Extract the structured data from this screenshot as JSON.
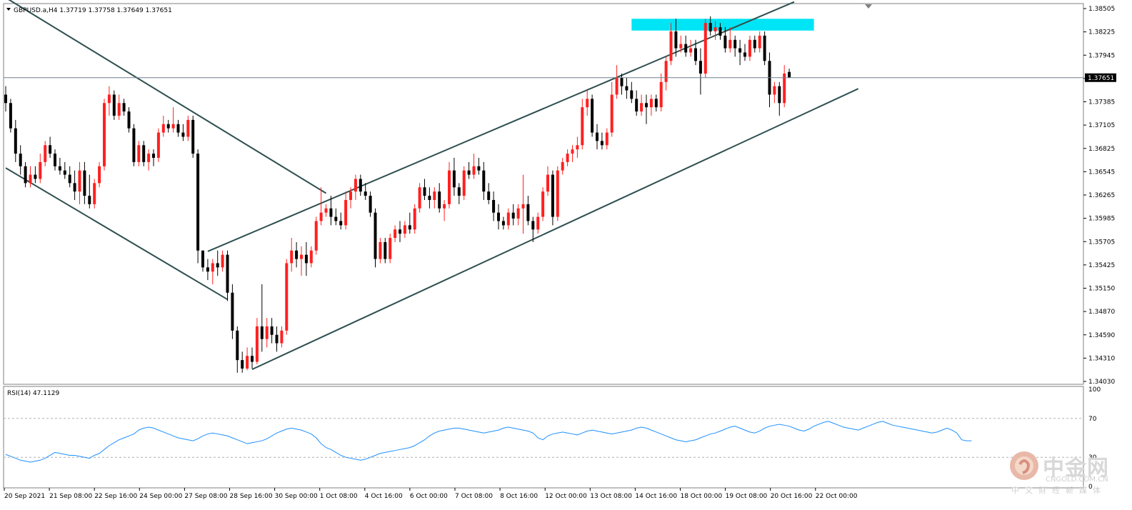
{
  "chart_header": {
    "symbol_line": "GBPUSD.a,H4  1.37719 1.37758 1.37649 1.37651",
    "current_price_label": "1.37651"
  },
  "rsi_header": "RSI(14) 47.1129",
  "price_axis_labels": [
    "1.38505",
    "1.38225",
    "1.37945",
    "1.37665",
    "1.37385",
    "1.37105",
    "1.36825",
    "1.36545",
    "1.36265",
    "1.35985",
    "1.35705",
    "1.35425",
    "1.35150",
    "1.34870",
    "1.34590",
    "1.34310",
    "1.34030"
  ],
  "rsi_axis_labels": [
    "100",
    "70",
    "30",
    "0"
  ],
  "time_axis_labels": [
    "20 Sep 2021",
    "21 Sep 08:00",
    "22 Sep 16:00",
    "24 Sep 00:00",
    "27 Sep 08:00",
    "28 Sep 16:00",
    "30 Sep 00:00",
    "1 Oct 08:00",
    "4 Oct 16:00",
    "6 Oct 00:00",
    "7 Oct 08:00",
    "8 Oct 16:00",
    "12 Oct 00:00",
    "13 Oct 08:00",
    "14 Oct 16:00",
    "18 Oct 00:00",
    "19 Oct 08:00",
    "20 Oct 16:00",
    "22 Oct 00:00"
  ],
  "watermark": {
    "cn": "中金网",
    "en": "CNGOLD.COM.CN",
    "sub": "中文财经新媒体"
  },
  "colors": {
    "bull": "#ff2020",
    "bear": "#000000",
    "neutral": "#00c000",
    "resistance_zone": "#00e5f5",
    "rsi_line": "#1e90ff",
    "trendline": "#2f4f4f"
  },
  "chart_data": {
    "type": "candlestick",
    "symbol": "GBPUSD.a",
    "timeframe": "H4",
    "ylim": [
      1.3403,
      1.38505
    ],
    "candles": [
      [
        1.3745,
        1.3755,
        1.3725,
        1.3735
      ],
      [
        1.3735,
        1.374,
        1.37,
        1.3705
      ],
      [
        1.3705,
        1.3715,
        1.3665,
        1.3675
      ],
      [
        1.3675,
        1.3685,
        1.365,
        1.366
      ],
      [
        1.366,
        1.3665,
        1.3635,
        1.364
      ],
      [
        1.364,
        1.366,
        1.3635,
        1.365
      ],
      [
        1.365,
        1.366,
        1.364,
        1.3645
      ],
      [
        1.3645,
        1.3675,
        1.364,
        1.3665
      ],
      [
        1.3665,
        1.369,
        1.366,
        1.3685
      ],
      [
        1.3685,
        1.3695,
        1.367,
        1.3675
      ],
      [
        1.3675,
        1.368,
        1.3655,
        1.366
      ],
      [
        1.366,
        1.367,
        1.365,
        1.3655
      ],
      [
        1.3655,
        1.3665,
        1.3645,
        1.365
      ],
      [
        1.365,
        1.366,
        1.3635,
        1.364
      ],
      [
        1.364,
        1.3655,
        1.362,
        1.363
      ],
      [
        1.363,
        1.3665,
        1.3615,
        1.3655
      ],
      [
        1.3655,
        1.3665,
        1.3615,
        1.3625
      ],
      [
        1.3625,
        1.365,
        1.361,
        1.3615
      ],
      [
        1.3615,
        1.3645,
        1.361,
        1.364
      ],
      [
        1.364,
        1.3665,
        1.3635,
        1.366
      ],
      [
        1.366,
        1.374,
        1.3655,
        1.3735
      ],
      [
        1.3735,
        1.3755,
        1.372,
        1.3745
      ],
      [
        1.3745,
        1.375,
        1.3715,
        1.372
      ],
      [
        1.372,
        1.3745,
        1.3715,
        1.3735
      ],
      [
        1.3735,
        1.374,
        1.372,
        1.3725
      ],
      [
        1.3725,
        1.373,
        1.37,
        1.3705
      ],
      [
        1.3705,
        1.371,
        1.366,
        1.3665
      ],
      [
        1.3665,
        1.369,
        1.366,
        1.3685
      ],
      [
        1.3685,
        1.369,
        1.366,
        1.3665
      ],
      [
        1.3665,
        1.368,
        1.3655,
        1.3675
      ],
      [
        1.3675,
        1.368,
        1.366,
        1.367
      ],
      [
        1.367,
        1.3705,
        1.3665,
        1.37
      ],
      [
        1.37,
        1.372,
        1.3695,
        1.371
      ],
      [
        1.371,
        1.3715,
        1.37,
        1.3705
      ],
      [
        1.3705,
        1.373,
        1.37,
        1.371
      ],
      [
        1.371,
        1.3715,
        1.3695,
        1.37
      ],
      [
        1.37,
        1.371,
        1.369,
        1.3695
      ],
      [
        1.3695,
        1.372,
        1.369,
        1.3715
      ],
      [
        1.3715,
        1.372,
        1.367,
        1.3675
      ],
      [
        1.3675,
        1.368,
        1.3545,
        1.356
      ],
      [
        1.356,
        1.356,
        1.3535,
        1.354
      ],
      [
        1.354,
        1.355,
        1.3525,
        1.3535
      ],
      [
        1.3535,
        1.355,
        1.352,
        1.3545
      ],
      [
        1.3545,
        1.356,
        1.353,
        1.354
      ],
      [
        1.354,
        1.356,
        1.3535,
        1.3555
      ],
      [
        1.3555,
        1.356,
        1.35,
        1.351
      ],
      [
        1.351,
        1.352,
        1.3455,
        1.3465
      ],
      [
        1.3465,
        1.347,
        1.3415,
        1.343
      ],
      [
        1.343,
        1.344,
        1.3415,
        1.342
      ],
      [
        1.342,
        1.3445,
        1.3418,
        1.3435
      ],
      [
        1.3435,
        1.3445,
        1.342,
        1.3428
      ],
      [
        1.3428,
        1.348,
        1.3425,
        1.347
      ],
      [
        1.347,
        1.352,
        1.344,
        1.3455
      ],
      [
        1.3455,
        1.348,
        1.3445,
        1.347
      ],
      [
        1.347,
        1.348,
        1.345,
        1.346
      ],
      [
        1.346,
        1.347,
        1.344,
        1.345
      ],
      [
        1.345,
        1.347,
        1.3445,
        1.3465
      ],
      [
        1.3465,
        1.355,
        1.346,
        1.3545
      ],
      [
        1.3545,
        1.3575,
        1.3535,
        1.356
      ],
      [
        1.356,
        1.357,
        1.354,
        1.355
      ],
      [
        1.355,
        1.3565,
        1.353,
        1.3555
      ],
      [
        1.3555,
        1.357,
        1.353,
        1.3545
      ],
      [
        1.3545,
        1.3565,
        1.354,
        1.356
      ],
      [
        1.356,
        1.36,
        1.3555,
        1.3595
      ],
      [
        1.3595,
        1.3635,
        1.359,
        1.3605
      ],
      [
        1.3605,
        1.3615,
        1.36,
        1.361
      ],
      [
        1.361,
        1.3625,
        1.359,
        1.36
      ],
      [
        1.36,
        1.361,
        1.359,
        1.3595
      ],
      [
        1.3595,
        1.3605,
        1.3585,
        1.359
      ],
      [
        1.359,
        1.363,
        1.3585,
        1.362
      ],
      [
        1.362,
        1.3635,
        1.361,
        1.363
      ],
      [
        1.363,
        1.365,
        1.362,
        1.3645
      ],
      [
        1.3645,
        1.365,
        1.3625,
        1.363
      ],
      [
        1.363,
        1.364,
        1.362,
        1.3625
      ],
      [
        1.3625,
        1.363,
        1.36,
        1.3605
      ],
      [
        1.3605,
        1.361,
        1.354,
        1.355
      ],
      [
        1.355,
        1.3575,
        1.3545,
        1.357
      ],
      [
        1.357,
        1.3575,
        1.3545,
        1.355
      ],
      [
        1.355,
        1.358,
        1.3545,
        1.3575
      ],
      [
        1.3575,
        1.359,
        1.357,
        1.3585
      ],
      [
        1.3585,
        1.3595,
        1.357,
        1.358
      ],
      [
        1.358,
        1.3595,
        1.3575,
        1.359
      ],
      [
        1.359,
        1.3605,
        1.358,
        1.3585
      ],
      [
        1.3585,
        1.3615,
        1.358,
        1.361
      ],
      [
        1.361,
        1.364,
        1.3605,
        1.3635
      ],
      [
        1.3635,
        1.3645,
        1.362,
        1.3625
      ],
      [
        1.3625,
        1.3635,
        1.361,
        1.362
      ],
      [
        1.362,
        1.3635,
        1.361,
        1.363
      ],
      [
        1.363,
        1.364,
        1.3605,
        1.361
      ],
      [
        1.361,
        1.362,
        1.3595,
        1.3615
      ],
      [
        1.3615,
        1.3665,
        1.361,
        1.3655
      ],
      [
        1.3655,
        1.367,
        1.3625,
        1.3635
      ],
      [
        1.3635,
        1.364,
        1.3615,
        1.3625
      ],
      [
        1.3625,
        1.366,
        1.362,
        1.3655
      ],
      [
        1.3655,
        1.3665,
        1.3645,
        1.365
      ],
      [
        1.365,
        1.3675,
        1.3645,
        1.366
      ],
      [
        1.366,
        1.367,
        1.365,
        1.3655
      ],
      [
        1.3655,
        1.3665,
        1.362,
        1.363
      ],
      [
        1.363,
        1.364,
        1.3615,
        1.362
      ],
      [
        1.362,
        1.363,
        1.3595,
        1.3605
      ],
      [
        1.3605,
        1.3615,
        1.3585,
        1.3595
      ],
      [
        1.3595,
        1.36,
        1.3585,
        1.359
      ],
      [
        1.359,
        1.361,
        1.3585,
        1.3605
      ],
      [
        1.3605,
        1.3615,
        1.359,
        1.3598
      ],
      [
        1.3598,
        1.3615,
        1.359,
        1.361
      ],
      [
        1.361,
        1.365,
        1.358,
        1.3615
      ],
      [
        1.3615,
        1.3625,
        1.359,
        1.3595
      ],
      [
        1.3595,
        1.36,
        1.357,
        1.3585
      ],
      [
        1.3585,
        1.3605,
        1.358,
        1.36
      ],
      [
        1.36,
        1.3635,
        1.3595,
        1.363
      ],
      [
        1.363,
        1.366,
        1.3625,
        1.365
      ],
      [
        1.365,
        1.3655,
        1.359,
        1.36
      ],
      [
        1.36,
        1.366,
        1.3595,
        1.3655
      ],
      [
        1.3655,
        1.367,
        1.365,
        1.3665
      ],
      [
        1.3665,
        1.368,
        1.366,
        1.3675
      ],
      [
        1.3675,
        1.3685,
        1.3665,
        1.368
      ],
      [
        1.368,
        1.3695,
        1.367,
        1.3685
      ],
      [
        1.3685,
        1.374,
        1.368,
        1.373
      ],
      [
        1.373,
        1.375,
        1.372,
        1.374
      ],
      [
        1.374,
        1.3745,
        1.3695,
        1.37
      ],
      [
        1.37,
        1.371,
        1.368,
        1.369
      ],
      [
        1.369,
        1.37,
        1.368,
        1.3685
      ],
      [
        1.3685,
        1.3705,
        1.368,
        1.37
      ],
      [
        1.37,
        1.376,
        1.3695,
        1.3745
      ],
      [
        1.3745,
        1.378,
        1.374,
        1.3765
      ],
      [
        1.3765,
        1.377,
        1.3745,
        1.3755
      ],
      [
        1.3755,
        1.3765,
        1.374,
        1.375
      ],
      [
        1.375,
        1.376,
        1.3735,
        1.374
      ],
      [
        1.374,
        1.375,
        1.372,
        1.3725
      ],
      [
        1.3725,
        1.3745,
        1.372,
        1.3735
      ],
      [
        1.3735,
        1.3745,
        1.371,
        1.373
      ],
      [
        1.373,
        1.3745,
        1.372,
        1.374
      ],
      [
        1.374,
        1.3745,
        1.3725,
        1.373
      ],
      [
        1.373,
        1.377,
        1.3725,
        1.376
      ],
      [
        1.376,
        1.379,
        1.375,
        1.3785
      ],
      [
        1.3785,
        1.383,
        1.378,
        1.382
      ],
      [
        1.382,
        1.3835,
        1.379,
        1.38
      ],
      [
        1.38,
        1.3815,
        1.3795,
        1.3805
      ],
      [
        1.3805,
        1.3815,
        1.379,
        1.3795
      ],
      [
        1.3795,
        1.381,
        1.379,
        1.38
      ],
      [
        1.38,
        1.381,
        1.378,
        1.3785
      ],
      [
        1.3785,
        1.38,
        1.3745,
        1.377
      ],
      [
        1.377,
        1.3835,
        1.3765,
        1.383
      ],
      [
        1.383,
        1.3838,
        1.3815,
        1.382
      ],
      [
        1.382,
        1.3832,
        1.381,
        1.3825
      ],
      [
        1.3825,
        1.383,
        1.381,
        1.3815
      ],
      [
        1.3815,
        1.3825,
        1.3795,
        1.38
      ],
      [
        1.38,
        1.3825,
        1.3795,
        1.381
      ],
      [
        1.381,
        1.3815,
        1.379,
        1.38
      ],
      [
        1.38,
        1.381,
        1.378,
        1.3795
      ],
      [
        1.3795,
        1.3805,
        1.3785,
        1.379
      ],
      [
        1.379,
        1.3815,
        1.3785,
        1.381
      ],
      [
        1.381,
        1.3815,
        1.3795,
        1.38
      ],
      [
        1.38,
        1.382,
        1.3795,
        1.3815
      ],
      [
        1.3815,
        1.382,
        1.378,
        1.3785
      ],
      [
        1.3785,
        1.3795,
        1.373,
        1.3745
      ],
      [
        1.3745,
        1.376,
        1.3735,
        1.3755
      ],
      [
        1.3755,
        1.376,
        1.372,
        1.3735
      ],
      [
        1.3735,
        1.378,
        1.373,
        1.377
      ],
      [
        1.37719,
        1.37758,
        1.37649,
        1.37651
      ]
    ],
    "rsi": {
      "label": "RSI(14) 47.1129",
      "ylim": [
        0,
        100
      ],
      "levels": [
        70,
        30
      ],
      "values": [
        33,
        31,
        29,
        27,
        26,
        25,
        26,
        27,
        29,
        32,
        35,
        34,
        33,
        32,
        32,
        31,
        30,
        29,
        32,
        34,
        38,
        42,
        45,
        48,
        50,
        52,
        54,
        58,
        60,
        61,
        60,
        58,
        56,
        54,
        52,
        50,
        49,
        48,
        47,
        49,
        52,
        54,
        55,
        54,
        53,
        52,
        50,
        48,
        46,
        44,
        45,
        46,
        47,
        49,
        52,
        55,
        57,
        59,
        60,
        59,
        58,
        56,
        54,
        50,
        44,
        40,
        38,
        35,
        32,
        30,
        29,
        28,
        27,
        28,
        30,
        32,
        34,
        35,
        36,
        37,
        38,
        39,
        40,
        42,
        45,
        48,
        52,
        55,
        57,
        58,
        59,
        60,
        60,
        59,
        58,
        57,
        56,
        55,
        56,
        57,
        58,
        60,
        61,
        60,
        59,
        58,
        57,
        55,
        50,
        48,
        52,
        54,
        55,
        56,
        55,
        54,
        53,
        55,
        57,
        58,
        57,
        56,
        55,
        54,
        55,
        56,
        57,
        58,
        60,
        61,
        60,
        58,
        56,
        54,
        52,
        50,
        48,
        47,
        46,
        47,
        48,
        50,
        52,
        54,
        55,
        57,
        59,
        61,
        62,
        60,
        58,
        56,
        55,
        57,
        60,
        62,
        63,
        64,
        63,
        62,
        60,
        58,
        57,
        59,
        62,
        64,
        66,
        67,
        65,
        63,
        61,
        60,
        59,
        58,
        60,
        62,
        64,
        66,
        67,
        65,
        63,
        62,
        61,
        60,
        59,
        58,
        57,
        56,
        55,
        56,
        58,
        60,
        58,
        55,
        48,
        47,
        47
      ]
    },
    "trendlines": [
      {
        "name": "descending-channel-upper",
        "from": [
          0,
          1.386
        ],
        "to": [
          65,
          1.3628
        ]
      },
      {
        "name": "descending-channel-lower",
        "from": [
          0,
          1.3658
        ],
        "to": [
          45,
          1.3502
        ]
      },
      {
        "name": "ascending-channel-upper",
        "from": [
          41,
          1.3559
        ],
        "to": [
          160,
          1.3855
        ]
      },
      {
        "name": "ascending-channel-lower",
        "from": [
          50,
          1.3419
        ],
        "to": [
          173,
          1.3752
        ]
      }
    ],
    "resistance_zone": {
      "x_from": 127,
      "x_to": 164,
      "y_low": 1.3821,
      "y_high": 1.3835
    },
    "current_price": 1.37651
  }
}
